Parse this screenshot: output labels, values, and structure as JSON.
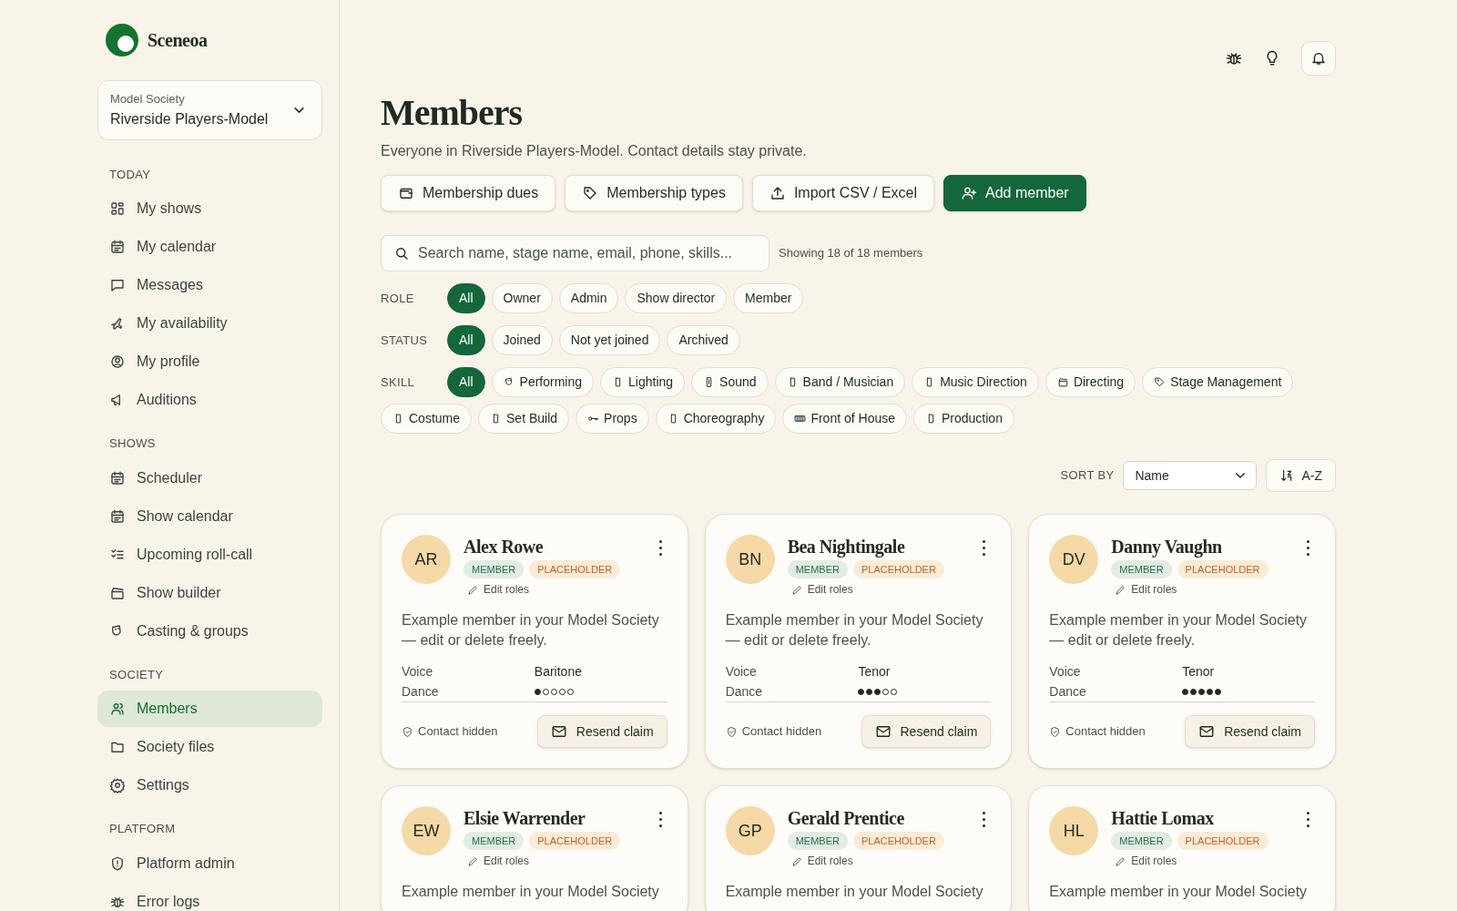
{
  "brand": {
    "name": "Sceneoa"
  },
  "society_selector": {
    "label": "Model Society",
    "value": "Riverside Players-Model"
  },
  "sidebar": {
    "sections": [
      {
        "heading": "TODAY",
        "items": [
          {
            "label": "My shows",
            "selected": false
          },
          {
            "label": "My calendar",
            "selected": false
          },
          {
            "label": "Messages",
            "selected": false
          },
          {
            "label": "My availability",
            "selected": false
          },
          {
            "label": "My profile",
            "selected": false
          },
          {
            "label": "Auditions",
            "selected": false
          }
        ]
      },
      {
        "heading": "SHOWS",
        "items": [
          {
            "label": "Scheduler",
            "selected": false
          },
          {
            "label": "Show calendar",
            "selected": false
          },
          {
            "label": "Upcoming roll-call",
            "selected": false
          },
          {
            "label": "Show builder",
            "selected": false
          },
          {
            "label": "Casting & groups",
            "selected": false
          }
        ]
      },
      {
        "heading": "SOCIETY",
        "items": [
          {
            "label": "Members",
            "selected": true
          },
          {
            "label": "Society files",
            "selected": false
          },
          {
            "label": "Settings",
            "selected": false
          }
        ]
      },
      {
        "heading": "PLATFORM",
        "items": [
          {
            "label": "Platform admin",
            "selected": false
          },
          {
            "label": "Error logs",
            "selected": false
          }
        ]
      }
    ]
  },
  "page": {
    "title": "Members",
    "subtitle": "Everyone in Riverside Players-Model. Contact details stay private."
  },
  "actions": [
    {
      "label": "Membership dues",
      "kind": "secondary"
    },
    {
      "label": "Membership types",
      "kind": "secondary"
    },
    {
      "label": "Import CSV / Excel",
      "kind": "secondary"
    },
    {
      "label": "Add member",
      "kind": "primary"
    }
  ],
  "search": {
    "placeholder": "Search name, stage name, email, phone, skills...",
    "count": "Showing 18 of 18 members"
  },
  "filters": [
    {
      "label": "ROLE",
      "options": [
        {
          "label": "All",
          "selected": true
        },
        {
          "label": "Owner",
          "selected": false
        },
        {
          "label": "Admin",
          "selected": false
        },
        {
          "label": "Show director",
          "selected": false
        },
        {
          "label": "Member",
          "selected": false
        }
      ]
    },
    {
      "label": "STATUS",
      "options": [
        {
          "label": "All",
          "selected": true
        },
        {
          "label": "Joined",
          "selected": false
        },
        {
          "label": "Not yet joined",
          "selected": false
        },
        {
          "label": "Archived",
          "selected": false
        }
      ]
    },
    {
      "label": "SKILL",
      "options": [
        {
          "label": "All",
          "selected": true
        },
        {
          "label": "Performing",
          "selected": false
        },
        {
          "label": "Lighting",
          "selected": false
        },
        {
          "label": "Sound",
          "selected": false
        },
        {
          "label": "Band / Musician",
          "selected": false
        },
        {
          "label": "Music Direction",
          "selected": false
        },
        {
          "label": "Directing",
          "selected": false
        },
        {
          "label": "Stage Management",
          "selected": false
        },
        {
          "label": "Costume",
          "selected": false
        },
        {
          "label": "Set Build",
          "selected": false
        },
        {
          "label": "Props",
          "selected": false
        },
        {
          "label": "Choreography",
          "selected": false
        },
        {
          "label": "Front of House",
          "selected": false
        },
        {
          "label": "Production",
          "selected": false
        }
      ]
    }
  ],
  "sort": {
    "label": "SORT BY",
    "value": "Name",
    "direction": "A-Z"
  },
  "members": [
    {
      "initials": "AR",
      "name": "Alex Rowe",
      "tags": [
        {
          "label": "MEMBER",
          "kind": "role"
        },
        {
          "label": "PLACEHOLDER",
          "kind": "status"
        }
      ],
      "edit": "Edit roles",
      "description": "Example member in your Model Society — edit or delete freely.",
      "voice_label": "Voice",
      "voice": "Baritone",
      "dance_label": "Dance",
      "stars": 1,
      "contact": "Contact hidden",
      "action": "Resend claim"
    },
    {
      "initials": "BN",
      "name": "Bea Nightingale",
      "tags": [
        {
          "label": "MEMBER",
          "kind": "role"
        },
        {
          "label": "PLACEHOLDER",
          "kind": "status"
        }
      ],
      "edit": "Edit roles",
      "description": "Example member in your Model Society — edit or delete freely.",
      "voice_label": "Voice",
      "voice": "Tenor",
      "dance_label": "Dance",
      "stars": 3,
      "contact": "Contact hidden",
      "action": "Resend claim"
    },
    {
      "initials": "DV",
      "name": "Danny Vaughn",
      "tags": [
        {
          "label": "MEMBER",
          "kind": "role"
        },
        {
          "label": "PLACEHOLDER",
          "kind": "status"
        }
      ],
      "edit": "Edit roles",
      "description": "Example member in your Model Society — edit or delete freely.",
      "voice_label": "Voice",
      "voice": "Tenor",
      "dance_label": "Dance",
      "stars": 5,
      "contact": "Contact hidden",
      "action": "Resend claim"
    },
    {
      "initials": "EW",
      "name": "Elsie Warrender",
      "tags": [
        {
          "label": "MEMBER",
          "kind": "role"
        },
        {
          "label": "PLACEHOLDER",
          "kind": "status"
        }
      ],
      "edit": "Edit roles",
      "description": "Example member in your Model Society"
    },
    {
      "initials": "GP",
      "name": "Gerald Prentice",
      "tags": [
        {
          "label": "MEMBER",
          "kind": "role"
        },
        {
          "label": "PLACEHOLDER",
          "kind": "status"
        }
      ],
      "edit": "Edit roles",
      "description": "Example member in your Model Society"
    },
    {
      "initials": "HL",
      "name": "Hattie Lomax",
      "tags": [
        {
          "label": "MEMBER",
          "kind": "role"
        },
        {
          "label": "PLACEHOLDER",
          "kind": "status"
        }
      ],
      "edit": "Edit roles",
      "description": "Example member in your Model Society"
    }
  ]
}
